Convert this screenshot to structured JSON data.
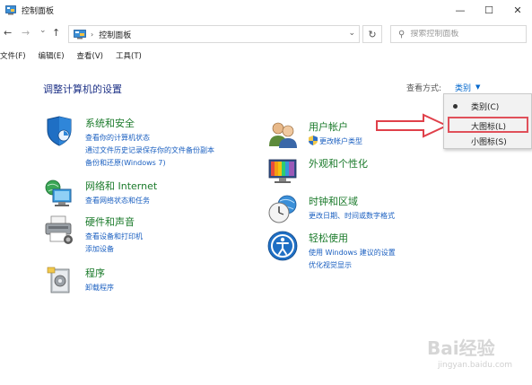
{
  "window": {
    "title": "控制面板",
    "controls": [
      "—",
      "☐",
      "✕"
    ]
  },
  "nav": {
    "back": "←",
    "forward": "→",
    "dropdown": "⌄",
    "up": "↑",
    "address_separator": "›",
    "address_text": "控制面板",
    "address_dropdown": "⌄",
    "refresh": "↻",
    "search_placeholder": "搜索控制面板"
  },
  "menu": [
    "文件(F)",
    "编辑(E)",
    "查看(V)",
    "工具(T)"
  ],
  "page": {
    "title": "调整计算机的设置",
    "view_by_label": "查看方式:",
    "view_by_value": "类别",
    "view_by_arrow": "▼"
  },
  "categories": [
    {
      "title": "系统和安全",
      "links": [
        "查看你的计算机状态",
        "通过文件历史记录保存你的文件备份副本",
        "备份和还原(Windows 7)"
      ],
      "icon": "shield-icon"
    },
    {
      "title": "网络和 Internet",
      "links": [
        "查看网络状态和任务"
      ],
      "icon": "network-icon"
    },
    {
      "title": "硬件和声音",
      "links": [
        "查看设备和打印机",
        "添加设备"
      ],
      "icon": "printer-icon"
    },
    {
      "title": "程序",
      "links": [
        "卸载程序"
      ],
      "icon": "programs-icon"
    },
    {
      "title": "用户帐户",
      "links": [
        "更改帐户类型"
      ],
      "icon": "users-icon"
    },
    {
      "title": "外观和个性化",
      "links": [],
      "icon": "appearance-icon"
    },
    {
      "title": "时钟和区域",
      "links": [
        "更改日期、时间或数字格式"
      ],
      "icon": "clock-icon"
    },
    {
      "title": "轻松使用",
      "links": [
        "使用 Windows 建议的设置",
        "优化视觉显示"
      ],
      "icon": "accessibility-icon"
    }
  ],
  "view_dropdown": {
    "items": [
      "类别(C)",
      "大图标(L)",
      "小图标(S)"
    ],
    "selected_index": 0,
    "highlighted_index": 1
  },
  "watermark": {
    "text": "Bai经验",
    "sub": "jingyan.baidu.com"
  },
  "colors": {
    "category_title": "#1a7a2a",
    "link": "#1a5fc0",
    "page_title": "#1e3287",
    "highlight_box": "#e0505a"
  }
}
